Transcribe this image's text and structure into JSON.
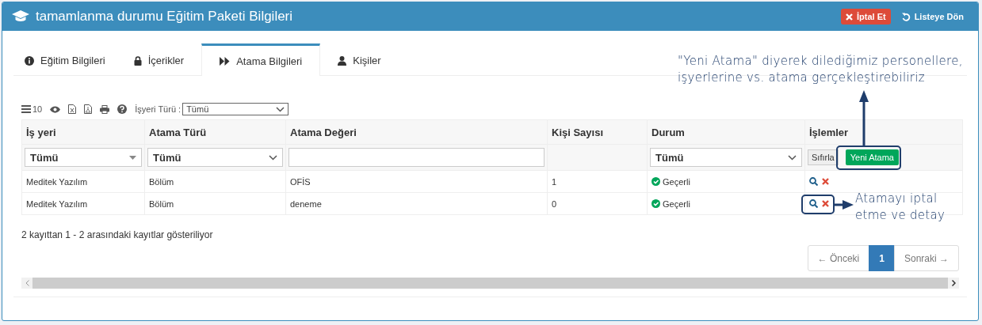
{
  "header": {
    "title": "tamamlanma durumu Eğitim Paketi Bilgileri",
    "actions": [
      {
        "label": "İptal Et",
        "kind": "danger"
      },
      {
        "label": "Listeye Dön",
        "kind": "back"
      }
    ]
  },
  "tabs": [
    {
      "label": "Eğitim Bilgileri",
      "kind": "info",
      "selected": false
    },
    {
      "label": "İçerikler",
      "kind": "lock",
      "selected": false
    },
    {
      "label": "Atama Bilgileri",
      "kind": "forward",
      "selected": true
    },
    {
      "label": "Kişiler",
      "kind": "user",
      "selected": false
    }
  ],
  "toolbar": {
    "page_size": "10",
    "filter_label": "İşyeri Türü :",
    "filter_value": "Tümü"
  },
  "table": {
    "columns": [
      "İş yeri",
      "Atama Türü",
      "Atama Değeri",
      "Kişi Sayısı",
      "Durum",
      "İşlemler"
    ],
    "filters": {
      "workplace": "Tümü",
      "type": "Tümü",
      "status": "Tümü",
      "reset": "Sıfırla",
      "new": "Yeni Atama"
    },
    "rows": [
      {
        "workplace": "Meditek Yazılım",
        "type": "Bölüm",
        "value": "OFİS",
        "count": "1",
        "status": "Geçerli",
        "kind": "valid"
      },
      {
        "workplace": "Meditek Yazılım",
        "type": "Bölüm",
        "value": "deneme",
        "count": "0",
        "status": "Geçerli",
        "kind": "valid"
      }
    ]
  },
  "info": "2 kayıttan 1 - 2 arasındaki kayıtlar gösteriliyor",
  "pagination": {
    "previous": "← Önceki",
    "pages": [
      {
        "label": "1",
        "selected": true
      }
    ],
    "next": "Sonraki →"
  },
  "annotations": [
    {
      "text": "\"Yeni Atama\" diyerek dilediğimiz personellere, işyerlerine vs. atama gerçekleştirebiliriz"
    },
    {
      "text": "Atamayı iptal etme ve detay"
    }
  ]
}
